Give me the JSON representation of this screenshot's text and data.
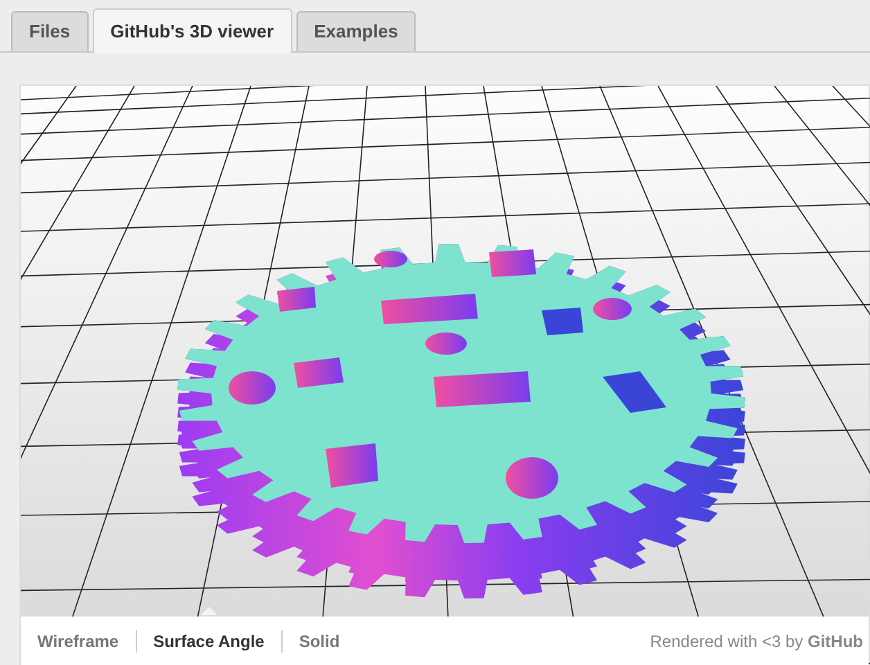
{
  "tabs": [
    {
      "label": "Files",
      "selected": false
    },
    {
      "label": "GitHub's 3D viewer",
      "selected": true
    },
    {
      "label": "Examples",
      "selected": false
    }
  ],
  "viewer": {
    "modes": [
      {
        "label": "Wireframe",
        "selected": false
      },
      {
        "label": "Surface Angle",
        "selected": true
      },
      {
        "label": "Solid",
        "selected": false
      }
    ],
    "credit": "Rendered with <3 by **GitHub**"
  }
}
